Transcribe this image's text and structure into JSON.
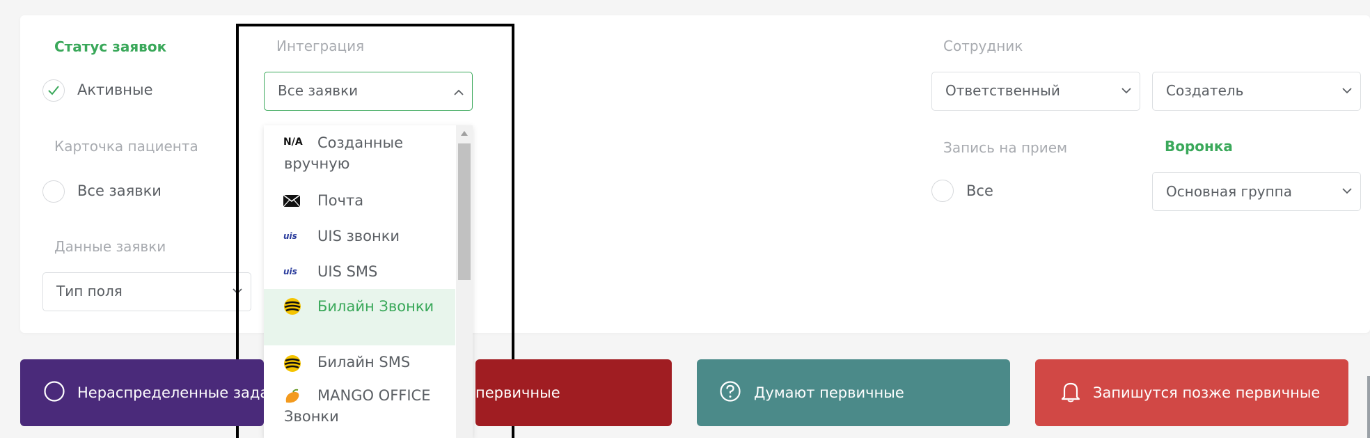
{
  "filters": {
    "status": {
      "title": "Статус заявок",
      "option": "Активные",
      "checked": true
    },
    "integration": {
      "title": "Интеграция",
      "selected": "Все заявки"
    },
    "employee": {
      "title": "Сотрудник",
      "responsible": "Ответственный",
      "creator": "Создатель"
    },
    "patient_card": {
      "title": "Карточка пациента",
      "option": "Все заявки"
    },
    "appointment": {
      "title": "Запись на прием",
      "option": "Все"
    },
    "funnel": {
      "title": "Воронка",
      "selected": "Основная группа"
    },
    "request_data": {
      "title": "Данные заявки",
      "field_type": "Тип поля"
    }
  },
  "integration_dropdown": {
    "items": [
      {
        "label": "Созданные вручную",
        "icon": "na-icon",
        "icon_text": "N/A"
      },
      {
        "label": "Почта",
        "icon": "mail-icon"
      },
      {
        "label": "UIS звонки",
        "icon": "uis-icon",
        "icon_text": "uis"
      },
      {
        "label": "UIS SMS",
        "icon": "uis-icon",
        "icon_text": "uis"
      },
      {
        "label": "Билайн Звонки",
        "icon": "beeline-icon",
        "highlighted": true
      },
      {
        "label": "Билайн SMS",
        "icon": "beeline-icon"
      },
      {
        "label": "MANGO OFFICE Звонки",
        "icon": "mango-icon"
      }
    ]
  },
  "buttons": {
    "unassigned": {
      "label": "Нераспределенные задачи",
      "color": "#4a2a7a",
      "icon": "circle-icon"
    },
    "primary": {
      "label": "первичные",
      "color": "#a01d22"
    },
    "thinking": {
      "label": "Думают первичные",
      "color": "#4b8a89",
      "icon": "question-icon"
    },
    "later": {
      "label": "Запишутся позже первичные",
      "color": "#d14845",
      "icon": "bell-icon"
    }
  },
  "colors": {
    "accent": "#3aa85a",
    "border": "#dcdfe2",
    "highlight_bg": "#e8f5ec"
  }
}
